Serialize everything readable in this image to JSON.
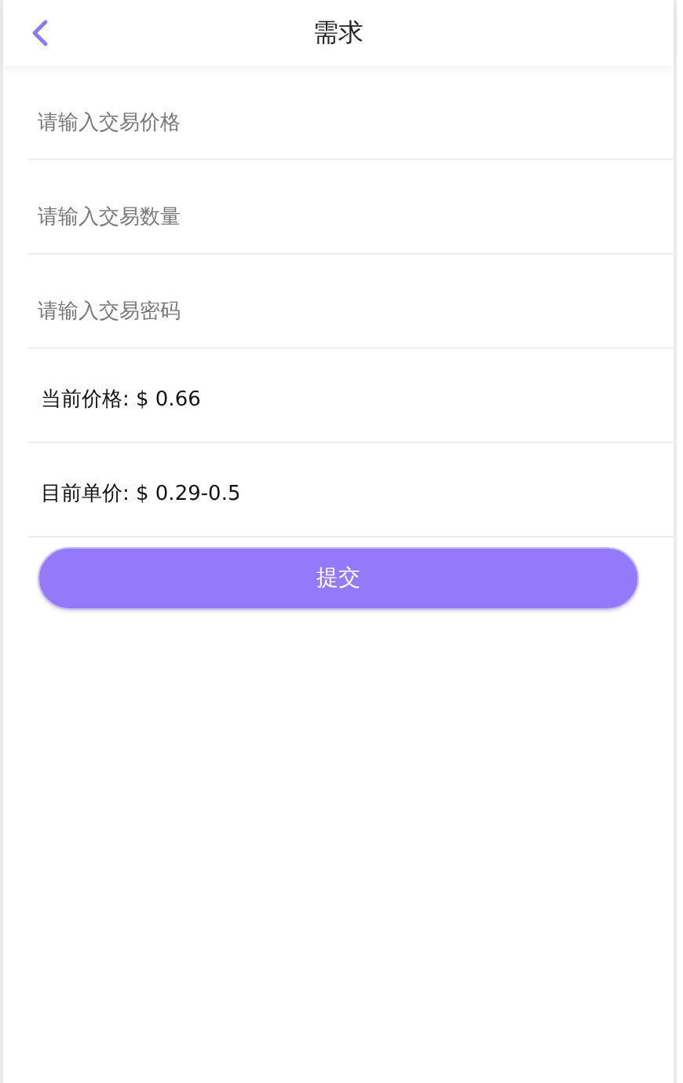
{
  "header": {
    "title": "需求"
  },
  "fields": [
    {
      "placeholder": "请输入交易价格"
    },
    {
      "placeholder": "请输入交易数量"
    },
    {
      "placeholder": "请输入交易密码"
    }
  ],
  "info": [
    "当前价格: $ 0.66",
    "目前单价: $ 0.29-0.5"
  ],
  "submit_button": "提交"
}
